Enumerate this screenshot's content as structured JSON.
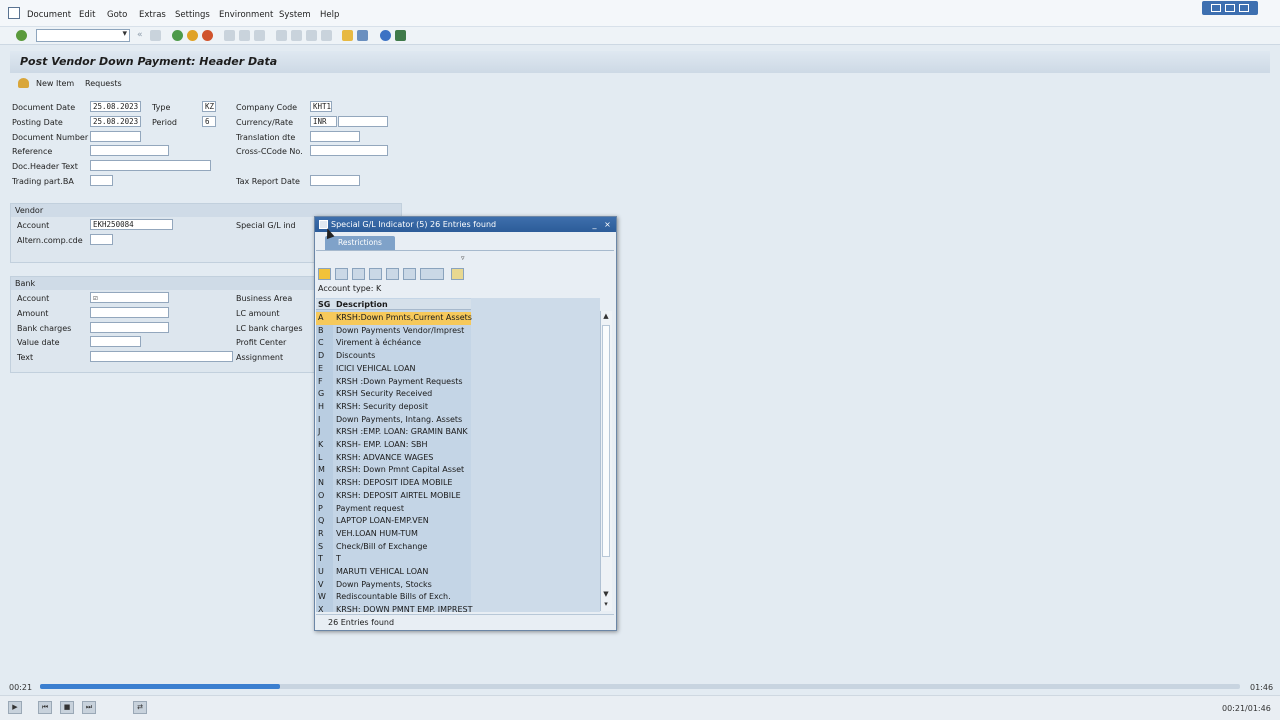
{
  "menu": [
    "Document",
    "Edit",
    "Goto",
    "Extras",
    "Settings",
    "Environment",
    "System",
    "Help"
  ],
  "page_title": "Post Vendor Down Payment: Header Data",
  "app_toolbar": {
    "new_item": "New Item",
    "requests": "Requests"
  },
  "header": {
    "document_date": {
      "label": "Document Date",
      "value": "25.08.2023"
    },
    "type": {
      "label": "Type",
      "value": "KZ"
    },
    "company_code": {
      "label": "Company Code",
      "value": "KHT1"
    },
    "posting_date": {
      "label": "Posting Date",
      "value": "25.08.2023"
    },
    "period": {
      "label": "Period",
      "value": "6"
    },
    "currency": {
      "label": "Currency/Rate",
      "value": "INR"
    },
    "document_number": {
      "label": "Document Number"
    },
    "translation_dte": {
      "label": "Translation dte"
    },
    "reference": {
      "label": "Reference"
    },
    "cross_ccode": {
      "label": "Cross-CCode No."
    },
    "doc_header_text": {
      "label": "Doc.Header Text"
    },
    "trading_part": {
      "label": "Trading part.BA"
    },
    "tax_report_date": {
      "label": "Tax Report Date"
    }
  },
  "vendor": {
    "title": "Vendor",
    "account": {
      "label": "Account",
      "value": "EKH250084"
    },
    "special_gl": {
      "label": "Special G/L ind"
    },
    "altern_comp": {
      "label": "Altern.comp.cde"
    }
  },
  "bank": {
    "title": "Bank",
    "account": {
      "label": "Account",
      "value": "☑"
    },
    "business_area": {
      "label": "Business Area"
    },
    "amount": {
      "label": "Amount"
    },
    "lc_amount": {
      "label": "LC amount"
    },
    "bank_charges": {
      "label": "Bank charges"
    },
    "lc_bank_charges": {
      "label": "LC bank charges"
    },
    "value_date": {
      "label": "Value date"
    },
    "profit_center": {
      "label": "Profit Center"
    },
    "text": {
      "label": "Text"
    },
    "assignment": {
      "label": "Assignment"
    }
  },
  "dialog": {
    "title": "Special G/L Indicator (5)   26 Entries found",
    "tab": "Restrictions",
    "account_type": "Account type: K",
    "col_key": "SG",
    "col_desc": "Description",
    "status": "26 Entries found",
    "rows": [
      {
        "k": "A",
        "d": "KRSH:Down Pmnts,Current Assets"
      },
      {
        "k": "B",
        "d": "Down Payments Vendor/Imprest"
      },
      {
        "k": "C",
        "d": "Virement à échéance"
      },
      {
        "k": "D",
        "d": "Discounts"
      },
      {
        "k": "E",
        "d": "ICICI VEHICAL LOAN"
      },
      {
        "k": "F",
        "d": "KRSH :Down Payment Requests"
      },
      {
        "k": "G",
        "d": "KRSH Security Received"
      },
      {
        "k": "H",
        "d": "KRSH: Security deposit"
      },
      {
        "k": "I",
        "d": "Down Payments, Intang. Assets"
      },
      {
        "k": "J",
        "d": "KRSH :EMP. LOAN: GRAMIN BANK"
      },
      {
        "k": "K",
        "d": "KRSH- EMP. LOAN: SBH"
      },
      {
        "k": "L",
        "d": "KRSH: ADVANCE WAGES"
      },
      {
        "k": "M",
        "d": "KRSH: Down Pmnt Capital Asset"
      },
      {
        "k": "N",
        "d": "KRSH: DEPOSIT IDEA MOBILE"
      },
      {
        "k": "O",
        "d": "KRSH: DEPOSIT AIRTEL MOBILE"
      },
      {
        "k": "P",
        "d": "Payment request"
      },
      {
        "k": "Q",
        "d": "LAPTOP LOAN-EMP.VEN"
      },
      {
        "k": "R",
        "d": "VEH.LOAN HUM-TUM"
      },
      {
        "k": "S",
        "d": "Check/Bill of Exchange"
      },
      {
        "k": "T",
        "d": "T"
      },
      {
        "k": "U",
        "d": "MARUTI VEHICAL LOAN"
      },
      {
        "k": "V",
        "d": "Down Payments, Stocks"
      },
      {
        "k": "W",
        "d": "Rediscountable Bills of Exch."
      },
      {
        "k": "X",
        "d": "KRSH: DOWN PMNT EMP. IMPREST"
      }
    ]
  },
  "player": {
    "elapsed": "00:21",
    "total": "01:46",
    "counter": "00:21/01:46",
    "progress": 0.2
  }
}
